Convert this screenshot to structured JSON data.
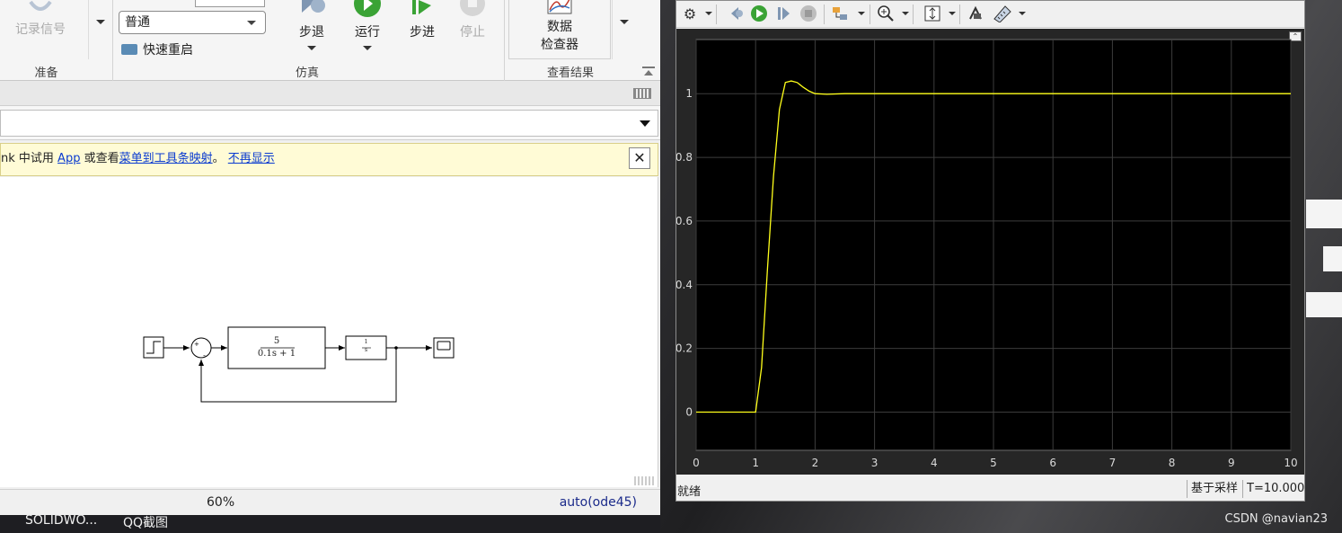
{
  "simulink": {
    "ribbon": {
      "prepare": {
        "section_label": "准备",
        "log_signals_label": "记录信号"
      },
      "simulate": {
        "section_label": "仿真",
        "mode_select_value": "普通",
        "fast_restart_label": "快速重启",
        "step_back_label": "步退",
        "run_label": "运行",
        "step_forward_label": "步进",
        "stop_label": "停止"
      },
      "review": {
        "section_label": "查看结果",
        "data_inspector_label_line1": "数据",
        "data_inspector_label_line2": "检查器"
      }
    },
    "notification": {
      "text_prefix": "nk 中试用",
      "app_link": "App",
      "text_middle": "或查看",
      "menu_map_link": "菜单到工具条映射",
      "text_sep": "。",
      "dismiss_link": "不再显示",
      "close_glyph": "✕"
    },
    "diagram": {
      "transfer_fn_numerator": "5",
      "transfer_fn_denominator": "0.1s + 1",
      "integrator_numerator": "1",
      "integrator_denominator": "s"
    },
    "statusbar": {
      "zoom": "60%",
      "solver": "auto(ode45)"
    }
  },
  "scope": {
    "status_left": "就绪",
    "sample_mode": "基于采样",
    "time_readout": "T=10.000"
  },
  "chart_data": {
    "type": "line",
    "title": "",
    "xlabel": "",
    "ylabel": "",
    "xlim": [
      0,
      10
    ],
    "ylim": [
      -0.12,
      1.17
    ],
    "xticks": [
      "0",
      "1",
      "2",
      "3",
      "4",
      "5",
      "6",
      "7",
      "8",
      "9",
      "10"
    ],
    "yticks": [
      "0",
      "0.2",
      "0.4",
      "0.6",
      "0.8",
      "1"
    ],
    "grid": true,
    "background": "#000000",
    "series": [
      {
        "color": "#ffff1a",
        "x": [
          0,
          1.0,
          1.1,
          1.2,
          1.3,
          1.4,
          1.5,
          1.6,
          1.7,
          1.8,
          1.9,
          2.0,
          2.2,
          2.5,
          3.0,
          10
        ],
        "y": [
          0,
          0,
          0.14,
          0.45,
          0.74,
          0.95,
          1.035,
          1.04,
          1.035,
          1.02,
          1.008,
          1.0,
          0.998,
          1.0,
          1.0,
          1.0
        ]
      }
    ]
  },
  "taskbar": {
    "item1": "SOLIDWO...",
    "item2": "QQ截图"
  },
  "watermark": "CSDN @navian23"
}
